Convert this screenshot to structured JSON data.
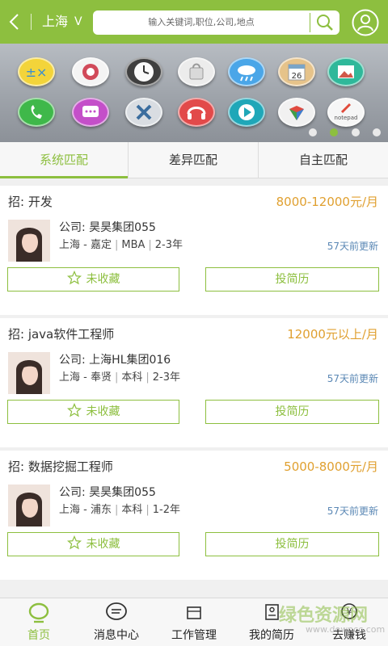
{
  "header": {
    "city": "上海",
    "city_arrow": "V",
    "search_placeholder": "输入关键词,职位,公司,地点"
  },
  "banner": {
    "apps": [
      "calculator",
      "camera",
      "clock",
      "shopping",
      "weather",
      "calendar",
      "gallery",
      "phone",
      "messages",
      "settings",
      "music",
      "video",
      "maps",
      "notepad"
    ],
    "calendar_day": "26",
    "notepad_label": "notepad",
    "slides": 4,
    "active_slide": 1
  },
  "tabs": [
    {
      "label": "系统匹配",
      "active": true
    },
    {
      "label": "差异匹配",
      "active": false
    },
    {
      "label": "自主匹配",
      "active": false
    }
  ],
  "jobs": [
    {
      "title": "招:  开发",
      "salary": "8000-12000元/月",
      "company": "公司:  昊昊集团055",
      "location": "上海 - 嘉定",
      "education": "MBA",
      "experience": "2-3年",
      "updated": "57天前更新",
      "favorite_label": "未收藏",
      "apply_label": "投简历"
    },
    {
      "title": "招:  java软件工程师",
      "salary": "12000元以上/月",
      "company": "公司:  上海HL集团016",
      "location": "上海 - 奉贤",
      "education": "本科",
      "experience": "2-3年",
      "updated": "57天前更新",
      "favorite_label": "未收藏",
      "apply_label": "投简历"
    },
    {
      "title": "招:  数据挖掘工程师",
      "salary": "5000-8000元/月",
      "company": "公司:  昊昊集团055",
      "location": "上海 - 浦东",
      "education": "本科",
      "experience": "1-2年",
      "updated": "57天前更新",
      "favorite_label": "未收藏",
      "apply_label": "投简历"
    }
  ],
  "bottom_nav": [
    {
      "label": "首页",
      "icon": "home-icon",
      "active": true
    },
    {
      "label": "消息中心",
      "icon": "message-icon",
      "active": false
    },
    {
      "label": "工作管理",
      "icon": "work-icon",
      "active": false
    },
    {
      "label": "我的简历",
      "icon": "resume-icon",
      "active": false
    },
    {
      "label": "去赚钱",
      "icon": "money-icon",
      "active": false
    }
  ],
  "watermark": {
    "text": "绿色资源网",
    "sub": "www.downcc.com"
  },
  "colors": {
    "accent": "#8dbf3f",
    "salary": "#e0a030",
    "updated": "#5b88b5"
  }
}
